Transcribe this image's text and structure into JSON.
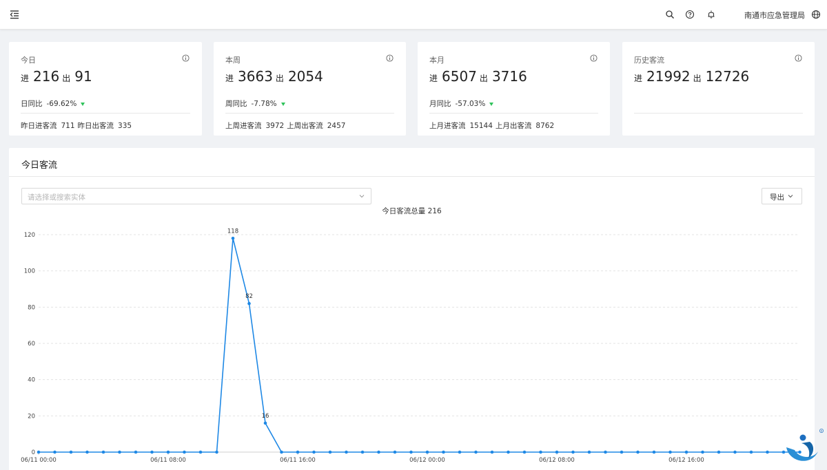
{
  "header": {
    "org_name": "南通市应急管理局",
    "icons": [
      "menu-fold-icon",
      "search-icon",
      "help-icon",
      "bell-icon",
      "globe-icon"
    ]
  },
  "cards": [
    {
      "title": "今日",
      "in_label": "进",
      "in_value": "216",
      "out_label": "出",
      "out_value": "91",
      "compare_label": "日同比",
      "compare_value": "-69.62%",
      "prev_in_label": "昨日进客流",
      "prev_in_value": "711",
      "prev_out_label": "昨日出客流",
      "prev_out_value": "335"
    },
    {
      "title": "本周",
      "in_label": "进",
      "in_value": "3663",
      "out_label": "出",
      "out_value": "2054",
      "compare_label": "周同比",
      "compare_value": "-7.78%",
      "prev_in_label": "上周进客流",
      "prev_in_value": "3972",
      "prev_out_label": "上周出客流",
      "prev_out_value": "2457"
    },
    {
      "title": "本月",
      "in_label": "进",
      "in_value": "6507",
      "out_label": "出",
      "out_value": "3716",
      "compare_label": "月同比",
      "compare_value": "-57.03%",
      "prev_in_label": "上月进客流",
      "prev_in_value": "15144",
      "prev_out_label": "上月出客流",
      "prev_out_value": "8762"
    },
    {
      "title": "历史客流",
      "in_label": "进",
      "in_value": "21992",
      "out_label": "出",
      "out_value": "12726"
    }
  ],
  "panel": {
    "title": "今日客流",
    "select_placeholder": "请选择或搜索实体",
    "export_label": "导出"
  },
  "colors": {
    "line": "#1e88e5",
    "trend_down": "#2fc25b"
  },
  "chart_data": {
    "type": "line",
    "title": "今日客流总量 216",
    "ylim": [
      0,
      120
    ],
    "y_ticks": [
      0,
      20,
      40,
      60,
      80,
      100,
      120
    ],
    "x_tick_labels": [
      "06/11 00:00",
      "06/11 08:00",
      "06/11 16:00",
      "06/12 00:00",
      "06/12 08:00",
      "06/12 16:00"
    ],
    "x_tick_indices": [
      0,
      8,
      16,
      24,
      32,
      40
    ],
    "grid": true,
    "series": [
      {
        "values": [
          0,
          0,
          0,
          0,
          0,
          0,
          0,
          0,
          0,
          0,
          0,
          0,
          118,
          82,
          16,
          0,
          0,
          0,
          0,
          0,
          0,
          0,
          0,
          0,
          0,
          0,
          0,
          0,
          0,
          0,
          0,
          0,
          0,
          0,
          0,
          0,
          0,
          0,
          0,
          0,
          0,
          0,
          0,
          0,
          0,
          0,
          0,
          0
        ],
        "labels": {
          "12": "118",
          "13": "82",
          "14": "16"
        }
      }
    ]
  }
}
